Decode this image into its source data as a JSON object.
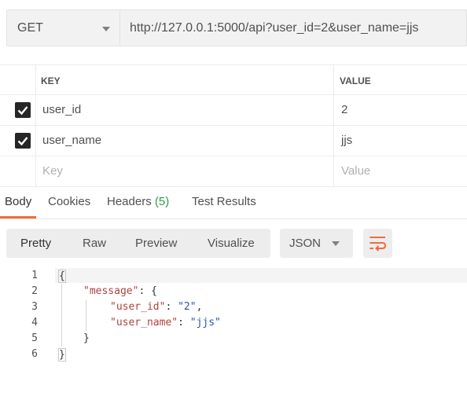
{
  "request": {
    "method": "GET",
    "url": "http://127.0.0.1:5000/api?user_id=2&user_name=jjs"
  },
  "params": {
    "key_header": "KEY",
    "value_header": "VALUE",
    "rows": [
      {
        "key": "user_id",
        "value": "2",
        "checked": true
      },
      {
        "key": "user_name",
        "value": "jjs",
        "checked": true
      }
    ],
    "key_placeholder": "Key",
    "value_placeholder": "Value"
  },
  "response_tabs": {
    "body": "Body",
    "cookies": "Cookies",
    "headers": "Headers",
    "headers_count": "(5)",
    "test_results": "Test Results",
    "active": "Body"
  },
  "view_modes": {
    "pretty": "Pretty",
    "raw": "Raw",
    "preview": "Preview",
    "visualize": "Visualize",
    "active": "Pretty"
  },
  "format": {
    "selected": "JSON"
  },
  "code": {
    "line_numbers": [
      "1",
      "2",
      "3",
      "4",
      "5",
      "6"
    ],
    "open_brace": "{",
    "message_key": "\"message\"",
    "colon_open": ": {",
    "user_id_key": "\"user_id\"",
    "user_id_value": "\"2\"",
    "user_name_key": "\"user_name\"",
    "user_name_value": "\"jjs\"",
    "inner_close": "}",
    "close_brace": "}"
  },
  "colors": {
    "accent": "#f26b3a",
    "count_green": "#2d9c49",
    "json_key": "#b0413e",
    "json_string": "#2b51b3"
  },
  "icons": {
    "wrap": "wrap-lines-icon",
    "checkbox": "checkmark-icon",
    "dropdown": "chevron-down-icon"
  }
}
